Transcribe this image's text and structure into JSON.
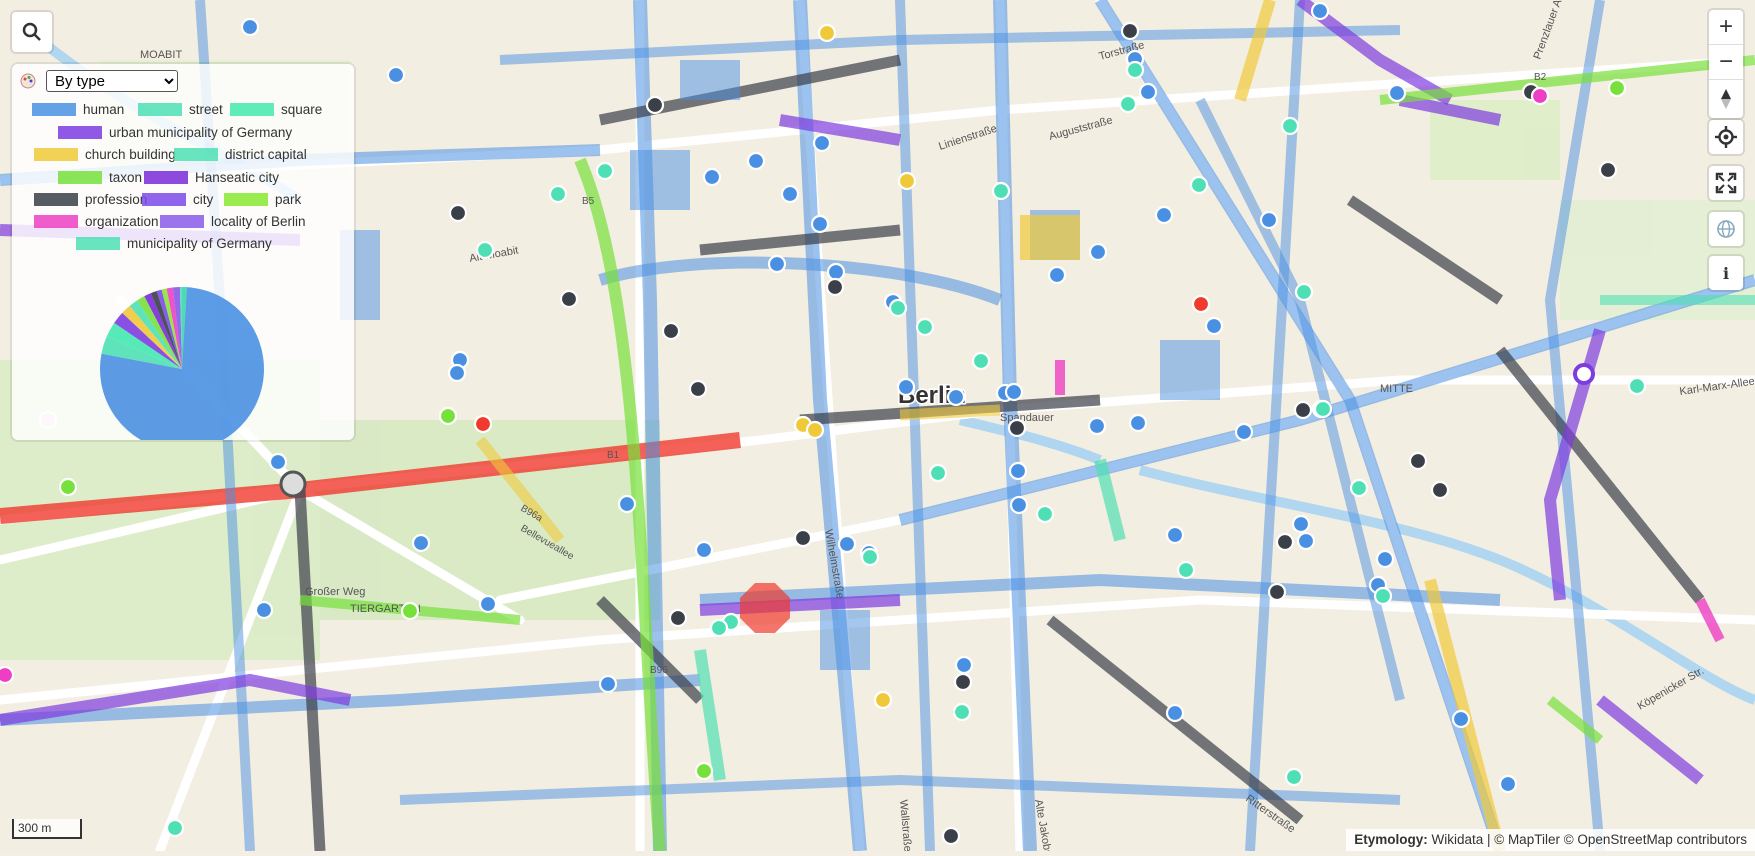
{
  "legend": {
    "mode_selected": "By type",
    "mode_options": [
      "By type"
    ],
    "entries": [
      {
        "label": "human",
        "color": "#4a90e2"
      },
      {
        "label": "street",
        "color": "#4ee0b4"
      },
      {
        "label": "square",
        "color": "#44e8b0"
      },
      {
        "label": "urban municipality of Germany",
        "color": "#7d3ce0"
      },
      {
        "label": "church building",
        "color": "#f0c93a"
      },
      {
        "label": "district capital",
        "color": "#4ee0b4"
      },
      {
        "label": "taxon",
        "color": "#77e03b"
      },
      {
        "label": "Hanseatic city",
        "color": "#7a2ad8"
      },
      {
        "label": "profession",
        "color": "#3a3f48"
      },
      {
        "label": "city",
        "color": "#7a4ae8"
      },
      {
        "label": "park",
        "color": "#88e830"
      },
      {
        "label": "organization",
        "color": "#ee3fc4"
      },
      {
        "label": "locality of Berlin",
        "color": "#8a5ae8"
      },
      {
        "label": "municipality of Germany",
        "color": "#4ee0b4"
      }
    ]
  },
  "map": {
    "city_label": "Berlin",
    "street_labels": [
      "MOABIT",
      "Alt-Moabit",
      "Linienstraße",
      "Auguststraße",
      "Torstraße",
      "Karl-Marx-Allee",
      "Spandauer",
      "Großer Weg",
      "TIERGARTEN",
      "Wilhelmstraße",
      "Wallstraße",
      "Alte Jakobstr.",
      "Köpenicker Str.",
      "Ritterstraße",
      "Prenzlauer Allee",
      "MITTE",
      "B5",
      "B2",
      "B1",
      "B96",
      "B96a",
      "Bellevueallee"
    ],
    "type_colors": {
      "human": "#4a90e2",
      "street": "#4ee0b4",
      "profession": "#3a3f48",
      "church": "#f0c93a",
      "org": "#ee3fc4",
      "highlight": "#f03a2e",
      "purple": "#7d3ce0",
      "green": "#77e03b"
    }
  },
  "controls": {
    "zoom_in": "+",
    "zoom_out": "−",
    "info": "i"
  },
  "scale_label": "300 m",
  "attribution": {
    "prefix": "Etymology:",
    "text": " Wikidata | © MapTiler © OpenStreetMap contributors"
  }
}
